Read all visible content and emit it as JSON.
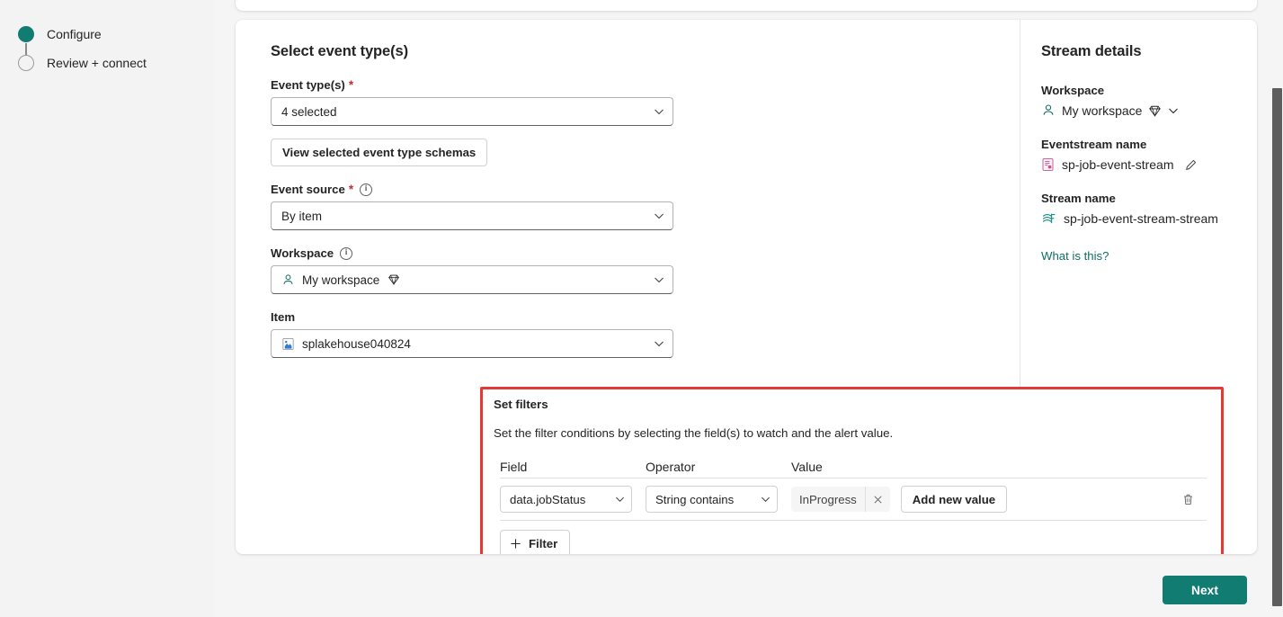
{
  "wizard": {
    "steps": [
      {
        "label": "Configure",
        "state": "done"
      },
      {
        "label": "Review + connect",
        "state": "todo"
      }
    ]
  },
  "main": {
    "section_title": "Select event type(s)",
    "fields": {
      "event_types": {
        "label": "Event type(s)",
        "required": "*",
        "value": "4 selected"
      },
      "view_schemas_button": "View selected event type schemas",
      "event_source": {
        "label": "Event source",
        "required": "*",
        "value": "By item"
      },
      "workspace": {
        "label": "Workspace",
        "value": "My workspace"
      },
      "item": {
        "label": "Item",
        "value": "splakehouse040824"
      }
    }
  },
  "filters": {
    "title": "Set filters",
    "description": "Set the filter conditions by selecting the field(s) to watch and the alert value.",
    "columns": [
      "Field",
      "Operator",
      "Value"
    ],
    "rows": [
      {
        "field": "data.jobStatus",
        "operator": "String contains",
        "values": [
          "InProgress"
        ],
        "add_value_label": "Add new value"
      }
    ],
    "add_filter_label": "Filter",
    "highlight_color": "#e23b35"
  },
  "details": {
    "title": "Stream details",
    "workspace_label": "Workspace",
    "workspace_value": "My workspace",
    "eventstream_label": "Eventstream name",
    "eventstream_value": "sp-job-event-stream",
    "stream_label": "Stream name",
    "stream_value": "sp-job-event-stream-stream",
    "help_link": "What is this?"
  },
  "footer": {
    "next_label": "Next",
    "next_color": "#107c72"
  }
}
